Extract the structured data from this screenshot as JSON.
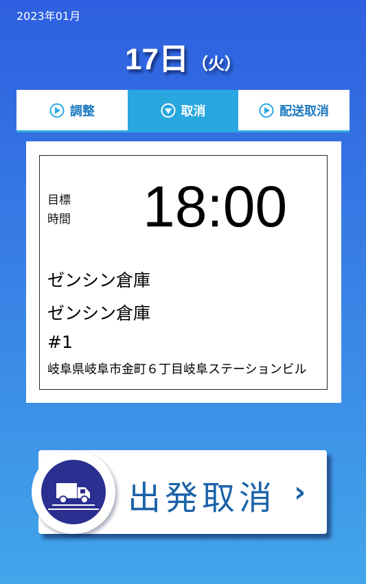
{
  "header": {
    "year_month": "2023年01月",
    "day": "17日",
    "weekday": "（火）"
  },
  "tabs": [
    {
      "label": "調整",
      "icon": "play-circle-icon",
      "active": false
    },
    {
      "label": "取消",
      "icon": "down-circle-icon",
      "active": true
    },
    {
      "label": "配送取消",
      "icon": "play-circle-icon",
      "active": false
    }
  ],
  "card": {
    "target_label_1": "目標",
    "target_label_2": "時間",
    "target_time": "18:00",
    "line1": "ゼンシン倉庫",
    "line2": "ゼンシン倉庫",
    "line3": "#1",
    "address": "岐阜県岐阜市金町６丁目岐阜ステーションビル"
  },
  "depart_button": {
    "label": "出発取消",
    "icon": "truck-icon",
    "chevron": "›"
  },
  "colors": {
    "accent": "#29a8e0",
    "tab_text": "#1b79bf",
    "button_text": "#1b63a8",
    "truck_circle": "#2b2f8f"
  }
}
